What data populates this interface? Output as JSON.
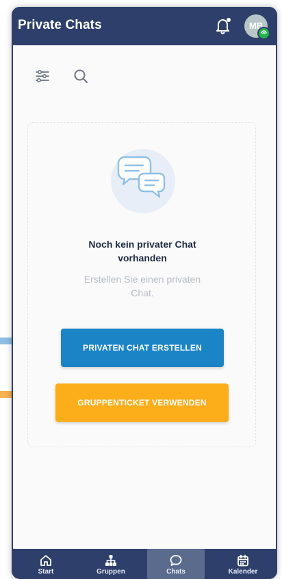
{
  "header": {
    "title": "Private Chats",
    "avatar_initials": "MB"
  },
  "toolbar": {
    "filter_icon": "sliders-icon",
    "search_icon": "search-icon"
  },
  "empty_state": {
    "title": "Noch kein privater Chat\nvorhanden",
    "subtitle": "Erstellen Sie einen privaten\nChat.",
    "illustration_icon": "chat-bubbles-icon"
  },
  "actions": {
    "primary_label": "PRIVATEN CHAT ERSTELLEN",
    "secondary_label": "GRUPPENTICKET VERWENDEN"
  },
  "bottom_nav": {
    "items": [
      {
        "label": "Start",
        "icon": "home-icon",
        "active": false
      },
      {
        "label": "Gruppen",
        "icon": "hierarchy-icon",
        "active": false
      },
      {
        "label": "Chats",
        "icon": "chat-icon",
        "active": true
      },
      {
        "label": "Kalender",
        "icon": "calendar-icon",
        "active": false
      }
    ]
  },
  "colors": {
    "header_bg": "#2e3f6c",
    "primary_button": "#1b84c6",
    "secondary_button": "#fcad1a",
    "online_badge": "#24b24a",
    "arrow_blue": "#8fbfe2",
    "arrow_orange": "#f6b24e"
  }
}
